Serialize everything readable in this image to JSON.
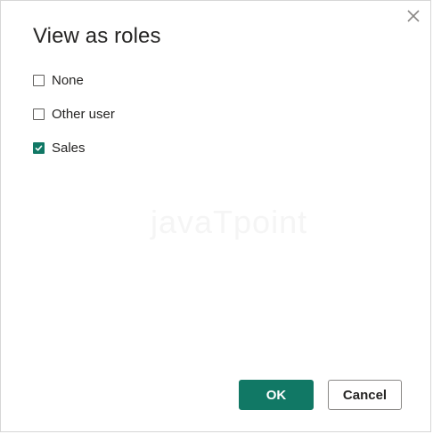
{
  "dialog": {
    "title": "View as roles",
    "close_icon": "close-icon"
  },
  "options": [
    {
      "label": "None",
      "checked": false
    },
    {
      "label": "Other user",
      "checked": false
    },
    {
      "label": "Sales",
      "checked": true
    }
  ],
  "watermark": "javaTpoint",
  "buttons": {
    "ok_label": "OK",
    "cancel_label": "Cancel"
  },
  "colors": {
    "accent": "#117865",
    "text": "#252423",
    "border": "#8a8886"
  }
}
